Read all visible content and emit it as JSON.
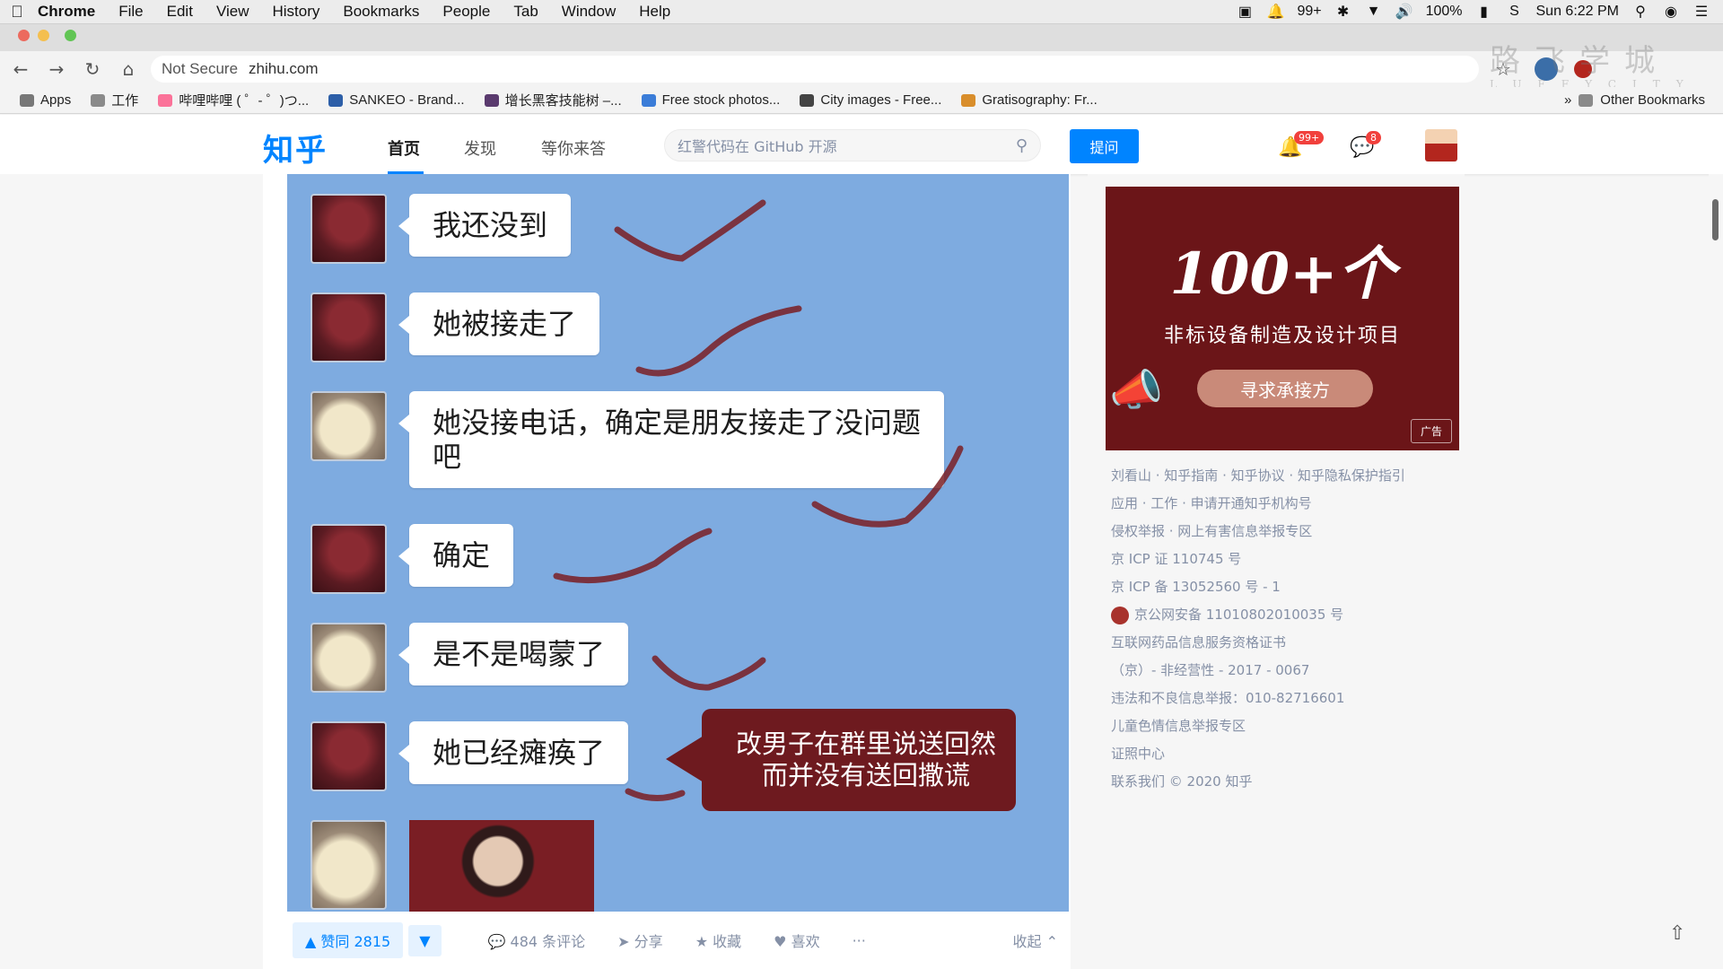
{
  "menubar": {
    "app": "Chrome",
    "items": [
      "File",
      "Edit",
      "View",
      "History",
      "Bookmarks",
      "People",
      "Tab",
      "Window",
      "Help"
    ],
    "notifications": "99+",
    "battery": "100%",
    "clock": "Sun 6:22 PM"
  },
  "browser": {
    "security": "Not Secure",
    "url": "zhihu.com",
    "watermark": "路飞学城",
    "watermark_sub": "LUFFYCITY"
  },
  "bookmarks": {
    "items": [
      "Apps",
      "工作",
      "哔哩哔哩 ( ゜- ゜)つ...",
      "SANKEO - Brand...",
      "增长黑客技能树 –...",
      "Free stock photos...",
      "City images - Free...",
      "Gratisography: Fr..."
    ],
    "overflow": "»",
    "other": "Other Bookmarks"
  },
  "zhihu": {
    "logo": "知乎",
    "tabs": [
      "首页",
      "发现",
      "等你来答"
    ],
    "search_placeholder": "红警代码在 GitHub 开源",
    "ask_label": "提问",
    "bell_badge": "99+",
    "msg_badge": "8"
  },
  "chat": {
    "messages": [
      "我还没到",
      "她被接走了",
      "她没接电话，确定是朋友接走了没问题吧",
      "确定",
      "是不是喝蒙了",
      "她已经瘫痪了"
    ],
    "note": "改男子在群里说送回然而并没有送回撒谎"
  },
  "actions": {
    "upvote": "▲ 赞同 2815",
    "downvote": "▼",
    "comments": "484 条评论",
    "share": "分享",
    "favorite": "收藏",
    "like": "喜欢",
    "more": "···",
    "collapse": "收起 ⌃"
  },
  "ad": {
    "headline": "100+个",
    "subtitle": "非标设备制造及设计项目",
    "button": "寻求承接方",
    "tag": "广告"
  },
  "footer_links": [
    "刘看山 · 知乎指南 · 知乎协议 · 知乎隐私保护指引",
    "应用 · 工作 · 申请开通知乎机构号",
    "侵权举报 · 网上有害信息举报专区",
    "京 ICP 证 110745 号",
    "京 ICP 备 13052560 号 - 1",
    "京公网安备 11010802010035 号",
    "互联网药品信息服务资格证书",
    "（京）- 非经营性 - 2017 - 0067",
    "违法和不良信息举报：010-82716601",
    "儿童色情信息举报专区",
    "证照中心",
    "联系我们 © 2020 知乎"
  ],
  "colors": {
    "zhihu_blue": "#0084ff",
    "chat_bg": "#7eabe0",
    "note_bg": "#6e1a1f",
    "ad_bg": "#6b1518",
    "scribble": "#7a1e24"
  }
}
